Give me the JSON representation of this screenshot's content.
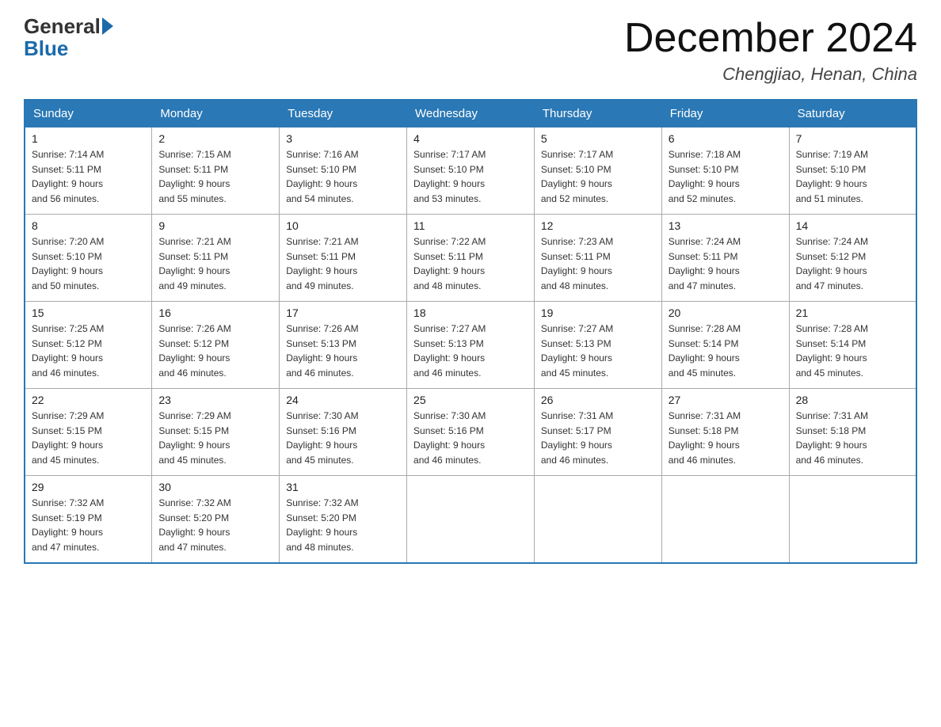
{
  "logo": {
    "general": "General",
    "blue": "Blue"
  },
  "title": "December 2024",
  "location": "Chengjiao, Henan, China",
  "days_of_week": [
    "Sunday",
    "Monday",
    "Tuesday",
    "Wednesday",
    "Thursday",
    "Friday",
    "Saturday"
  ],
  "weeks": [
    [
      {
        "day": "1",
        "info": "Sunrise: 7:14 AM\nSunset: 5:11 PM\nDaylight: 9 hours\nand 56 minutes."
      },
      {
        "day": "2",
        "info": "Sunrise: 7:15 AM\nSunset: 5:11 PM\nDaylight: 9 hours\nand 55 minutes."
      },
      {
        "day": "3",
        "info": "Sunrise: 7:16 AM\nSunset: 5:10 PM\nDaylight: 9 hours\nand 54 minutes."
      },
      {
        "day": "4",
        "info": "Sunrise: 7:17 AM\nSunset: 5:10 PM\nDaylight: 9 hours\nand 53 minutes."
      },
      {
        "day": "5",
        "info": "Sunrise: 7:17 AM\nSunset: 5:10 PM\nDaylight: 9 hours\nand 52 minutes."
      },
      {
        "day": "6",
        "info": "Sunrise: 7:18 AM\nSunset: 5:10 PM\nDaylight: 9 hours\nand 52 minutes."
      },
      {
        "day": "7",
        "info": "Sunrise: 7:19 AM\nSunset: 5:10 PM\nDaylight: 9 hours\nand 51 minutes."
      }
    ],
    [
      {
        "day": "8",
        "info": "Sunrise: 7:20 AM\nSunset: 5:10 PM\nDaylight: 9 hours\nand 50 minutes."
      },
      {
        "day": "9",
        "info": "Sunrise: 7:21 AM\nSunset: 5:11 PM\nDaylight: 9 hours\nand 49 minutes."
      },
      {
        "day": "10",
        "info": "Sunrise: 7:21 AM\nSunset: 5:11 PM\nDaylight: 9 hours\nand 49 minutes."
      },
      {
        "day": "11",
        "info": "Sunrise: 7:22 AM\nSunset: 5:11 PM\nDaylight: 9 hours\nand 48 minutes."
      },
      {
        "day": "12",
        "info": "Sunrise: 7:23 AM\nSunset: 5:11 PM\nDaylight: 9 hours\nand 48 minutes."
      },
      {
        "day": "13",
        "info": "Sunrise: 7:24 AM\nSunset: 5:11 PM\nDaylight: 9 hours\nand 47 minutes."
      },
      {
        "day": "14",
        "info": "Sunrise: 7:24 AM\nSunset: 5:12 PM\nDaylight: 9 hours\nand 47 minutes."
      }
    ],
    [
      {
        "day": "15",
        "info": "Sunrise: 7:25 AM\nSunset: 5:12 PM\nDaylight: 9 hours\nand 46 minutes."
      },
      {
        "day": "16",
        "info": "Sunrise: 7:26 AM\nSunset: 5:12 PM\nDaylight: 9 hours\nand 46 minutes."
      },
      {
        "day": "17",
        "info": "Sunrise: 7:26 AM\nSunset: 5:13 PM\nDaylight: 9 hours\nand 46 minutes."
      },
      {
        "day": "18",
        "info": "Sunrise: 7:27 AM\nSunset: 5:13 PM\nDaylight: 9 hours\nand 46 minutes."
      },
      {
        "day": "19",
        "info": "Sunrise: 7:27 AM\nSunset: 5:13 PM\nDaylight: 9 hours\nand 45 minutes."
      },
      {
        "day": "20",
        "info": "Sunrise: 7:28 AM\nSunset: 5:14 PM\nDaylight: 9 hours\nand 45 minutes."
      },
      {
        "day": "21",
        "info": "Sunrise: 7:28 AM\nSunset: 5:14 PM\nDaylight: 9 hours\nand 45 minutes."
      }
    ],
    [
      {
        "day": "22",
        "info": "Sunrise: 7:29 AM\nSunset: 5:15 PM\nDaylight: 9 hours\nand 45 minutes."
      },
      {
        "day": "23",
        "info": "Sunrise: 7:29 AM\nSunset: 5:15 PM\nDaylight: 9 hours\nand 45 minutes."
      },
      {
        "day": "24",
        "info": "Sunrise: 7:30 AM\nSunset: 5:16 PM\nDaylight: 9 hours\nand 45 minutes."
      },
      {
        "day": "25",
        "info": "Sunrise: 7:30 AM\nSunset: 5:16 PM\nDaylight: 9 hours\nand 46 minutes."
      },
      {
        "day": "26",
        "info": "Sunrise: 7:31 AM\nSunset: 5:17 PM\nDaylight: 9 hours\nand 46 minutes."
      },
      {
        "day": "27",
        "info": "Sunrise: 7:31 AM\nSunset: 5:18 PM\nDaylight: 9 hours\nand 46 minutes."
      },
      {
        "day": "28",
        "info": "Sunrise: 7:31 AM\nSunset: 5:18 PM\nDaylight: 9 hours\nand 46 minutes."
      }
    ],
    [
      {
        "day": "29",
        "info": "Sunrise: 7:32 AM\nSunset: 5:19 PM\nDaylight: 9 hours\nand 47 minutes."
      },
      {
        "day": "30",
        "info": "Sunrise: 7:32 AM\nSunset: 5:20 PM\nDaylight: 9 hours\nand 47 minutes."
      },
      {
        "day": "31",
        "info": "Sunrise: 7:32 AM\nSunset: 5:20 PM\nDaylight: 9 hours\nand 48 minutes."
      },
      {
        "day": "",
        "info": ""
      },
      {
        "day": "",
        "info": ""
      },
      {
        "day": "",
        "info": ""
      },
      {
        "day": "",
        "info": ""
      }
    ]
  ]
}
